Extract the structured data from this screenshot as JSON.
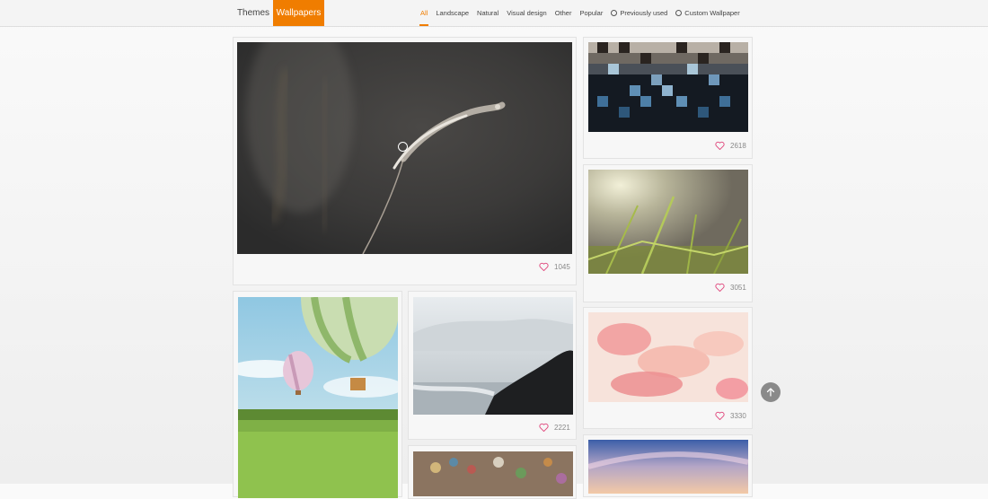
{
  "header": {
    "themes_label": "Themes",
    "wallpapers_label": "Wallpapers",
    "nav": [
      {
        "label": "All",
        "icon": null
      },
      {
        "label": "Landscape",
        "icon": null
      },
      {
        "label": "Natural",
        "icon": null
      },
      {
        "label": "Visual design",
        "icon": null
      },
      {
        "label": "Other",
        "icon": null
      },
      {
        "label": "Popular",
        "icon": null
      },
      {
        "label": "Previously used",
        "icon": "clock-icon"
      },
      {
        "label": "Custom Wallpaper",
        "icon": "circle-icon"
      }
    ]
  },
  "wallpapers": {
    "feature_likes": "1045",
    "mosaic_likes": "2618",
    "grass_likes": "3051",
    "petals_likes": "3330",
    "sea_likes": "2221"
  },
  "colors": {
    "accent": "#f07d00",
    "heart": "#e0457b"
  }
}
